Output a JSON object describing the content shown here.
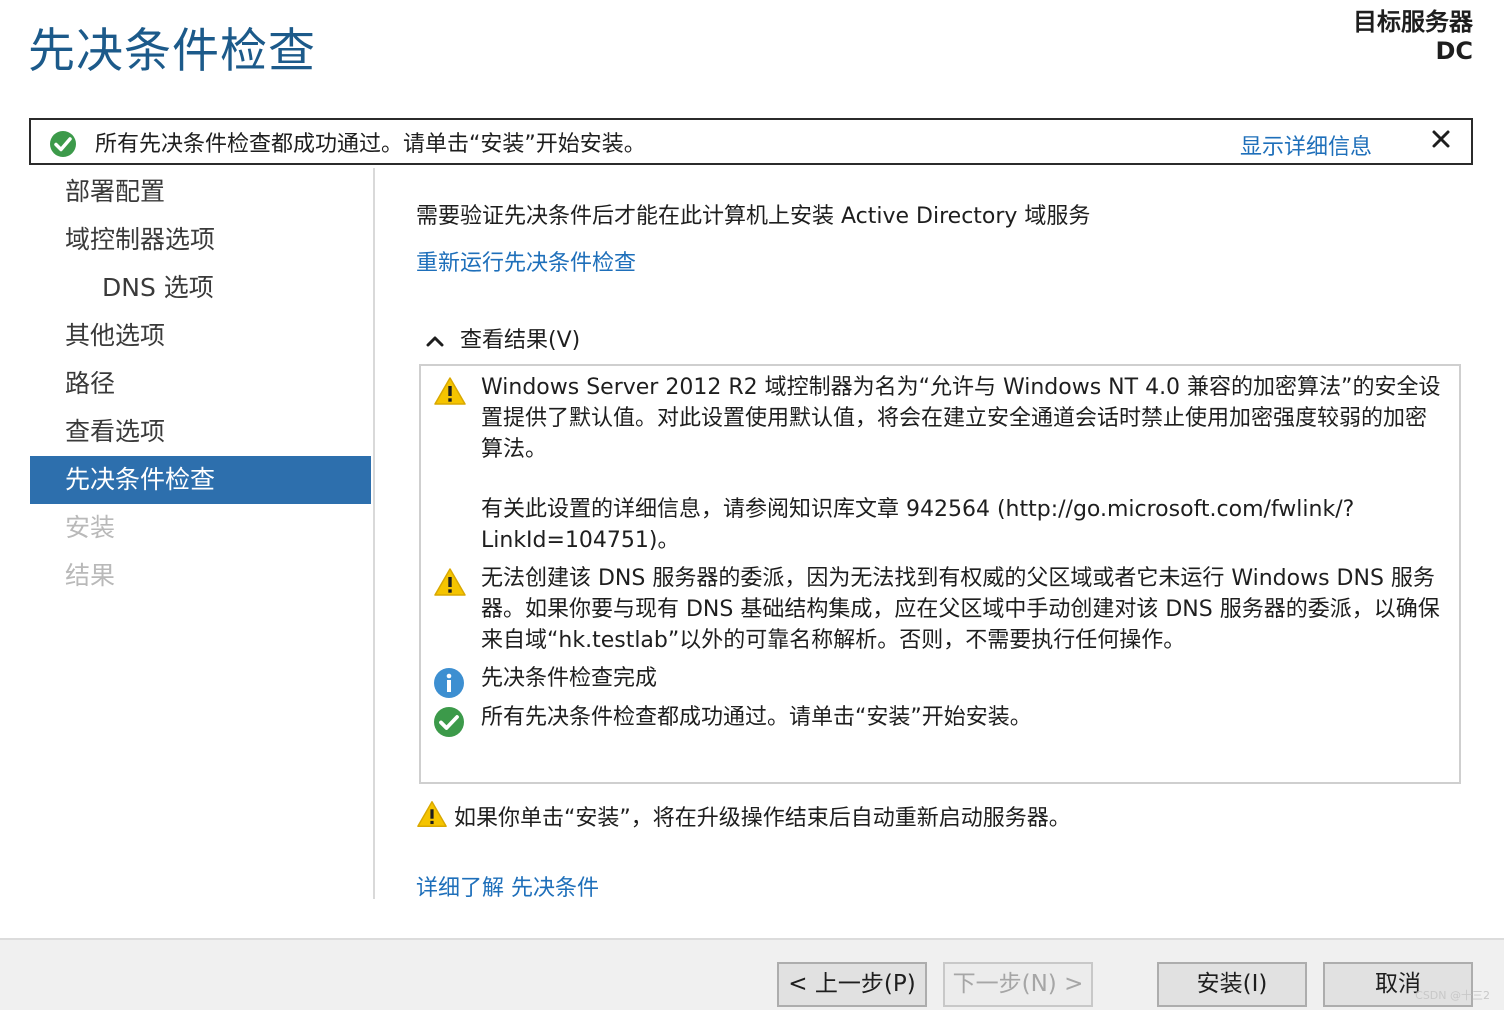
{
  "header": {
    "title": "先决条件检查",
    "target_label": "目标服务器",
    "target_value": "DC"
  },
  "notification": {
    "text": "所有先决条件检查都成功通过。请单击“安装”开始安装。",
    "details_link": "显示详细信息",
    "close_glyph": "✕"
  },
  "sidebar": {
    "items": [
      {
        "label": "部署配置",
        "state": "normal"
      },
      {
        "label": "域控制器选项",
        "state": "normal"
      },
      {
        "label": "DNS 选项",
        "state": "sub"
      },
      {
        "label": "其他选项",
        "state": "normal"
      },
      {
        "label": "路径",
        "state": "normal"
      },
      {
        "label": "查看选项",
        "state": "normal"
      },
      {
        "label": "先决条件检查",
        "state": "active"
      },
      {
        "label": "安装",
        "state": "disabled"
      },
      {
        "label": "结果",
        "state": "disabled"
      }
    ]
  },
  "main": {
    "intro": "需要验证先决条件后才能在此计算机上安装 Active Directory 域服务",
    "rerun_link": "重新运行先决条件检查",
    "results_header": "查看结果(V)",
    "results": [
      {
        "icon": "warning-icon",
        "text": "Windows Server 2012 R2 域控制器为名为“允许与 Windows NT 4.0 兼容的加密算法”的安全设置提供了默认值。对此设置使用默认值，将会在建立安全通道会话时禁止使用加密强度较弱的加密算法。"
      },
      {
        "icon": "none",
        "text": "有关此设置的详细信息，请参阅知识库文章 942564 (http://go.microsoft.com/fwlink/?LinkId=104751)。"
      },
      {
        "icon": "warning-icon",
        "text": "无法创建该 DNS 服务器的委派，因为无法找到有权威的父区域或者它未运行 Windows DNS 服务器。如果你要与现有 DNS 基础结构集成，应在父区域中手动创建对该 DNS 服务器的委派，以确保来自域“hk.testlab”以外的可靠名称解析。否则，不需要执行任何操作。"
      },
      {
        "icon": "info-icon",
        "text": "先决条件检查完成"
      },
      {
        "icon": "success-icon",
        "text": "所有先决条件检查都成功通过。请单击“安装”开始安装。"
      }
    ],
    "footer_warning": "如果你单击“安装”，将在升级操作结束后自动重新启动服务器。",
    "learn_more": "详细了解 先决条件"
  },
  "buttons": {
    "previous": "< 上一步(P)",
    "next": "下一步(N) >",
    "install": "安装(I)",
    "cancel": "取消"
  },
  "watermark": "CSDN @十三2",
  "colors": {
    "title": "#1c5a8a",
    "link": "#1e6fba",
    "active_nav": "#2d6fad",
    "warning": "#f5c400",
    "info": "#3d8fd1",
    "success": "#3c9a4a"
  }
}
